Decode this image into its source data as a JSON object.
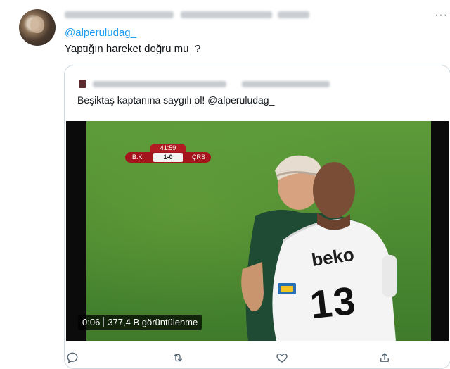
{
  "tweet": {
    "mention": "@alperuludag_",
    "text": "Yaptığın hareket doğru mu  ?",
    "more_glyph": "···"
  },
  "quote": {
    "text": "Beşiktaş kaptanına saygılı ol! @alperuludag_",
    "video": {
      "scorebug": {
        "time": "41:59",
        "home": "B.K",
        "score": "1-0",
        "away": "ÇRS"
      },
      "duration": "0:06",
      "views": "377,4 B görüntülenme",
      "jersey_sponsor": "beko",
      "jersey_number": "13"
    }
  },
  "actions": {
    "reply_icon": "reply-icon",
    "retweet_icon": "retweet-icon",
    "like_icon": "like-icon",
    "share_icon": "share-icon"
  },
  "colors": {
    "accent": "#1d9bf0",
    "text": "#0f1419",
    "muted": "#536471",
    "border": "#cfd9de",
    "scorebug": "#a3141c"
  }
}
